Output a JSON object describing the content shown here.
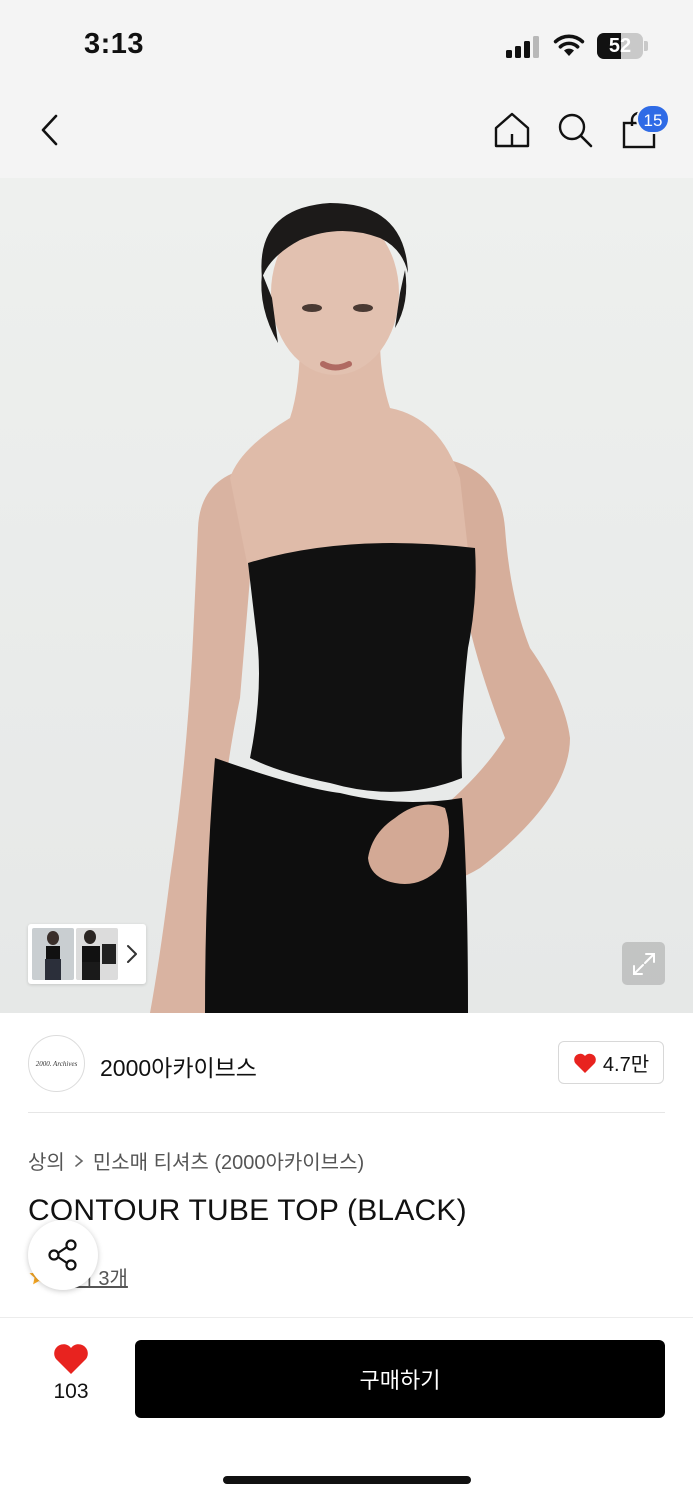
{
  "status_bar": {
    "time": "3:13",
    "battery": "52",
    "battery_level": 0.52
  },
  "nav": {
    "back_icon": "chevron-left-icon",
    "home_icon": "home-icon",
    "search_icon": "search-icon",
    "cart_icon": "shopping-bag-icon",
    "cart_count": "15"
  },
  "product_image": {
    "thumb_more_icon": "chevron-right-icon",
    "expand_icon": "expand-icon"
  },
  "brand": {
    "logo_text": "2000. Archives",
    "name": "2000아카이브스",
    "like_count": "4.7만"
  },
  "breadcrumb": {
    "category": "상의",
    "subcategory": "민소매 티셔츠 (2000아카이브스)"
  },
  "product": {
    "title": "CONTOUR TUBE TOP (BLACK)",
    "review_text": "후기 3개"
  },
  "actions": {
    "share_icon": "share-icon",
    "wish_count": "103",
    "buy_label": "구매하기"
  },
  "colors": {
    "accent_blue": "#2f6be6",
    "heart_red": "#e8231f",
    "primary_button": "#000000",
    "star": "#f5a623"
  }
}
